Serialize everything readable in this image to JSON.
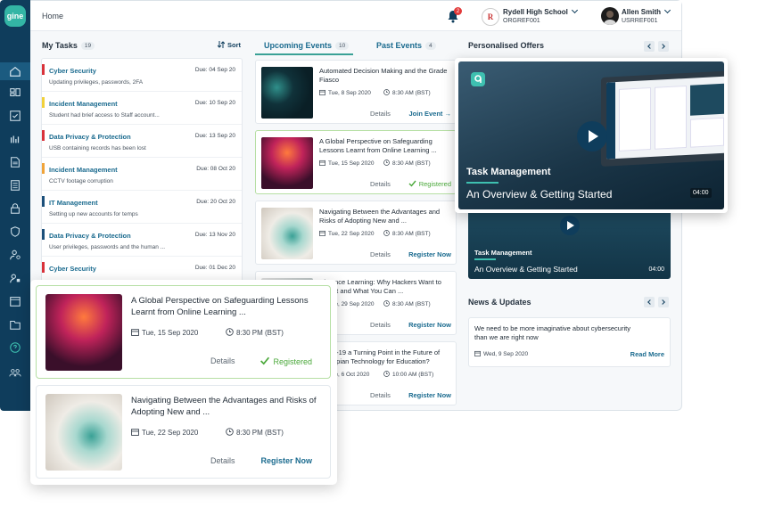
{
  "app": {
    "logo_text": "gine"
  },
  "topbar": {
    "breadcrumb": "Home",
    "notification_count": "2",
    "school_name": "Rydell High School",
    "school_code": "ORGREF001",
    "school_logo_letter": "R",
    "user_name": "Allen Smith",
    "user_code": "USRREF001"
  },
  "tasks": {
    "title": "My Tasks",
    "count": "19",
    "sort_label": "Sort",
    "items": [
      {
        "title": "Cyber Security",
        "due": "Due: 04 Sep 20",
        "desc": "Updating privileges, passwords, 2FA",
        "color": "#d9323a"
      },
      {
        "title": "Incident Management",
        "due": "Due: 10 Sep 20",
        "desc": "Student had brief access to Staff account...",
        "color": "#f1d13a"
      },
      {
        "title": "Data Privacy & Protection",
        "due": "Due: 13 Sep 20",
        "desc": "USB containing records has been lost",
        "color": "#d9323a"
      },
      {
        "title": "Incident Management",
        "due": "Due: 08 Oct 20",
        "desc": "CCTV footage corruption",
        "color": "#f0a43a"
      },
      {
        "title": "IT Management",
        "due": "Due: 20 Oct 20",
        "desc": "Setting up new accounts for temps",
        "color": "#1b4f7a"
      },
      {
        "title": "Data Privacy & Protection",
        "due": "Due: 13 Nov 20",
        "desc": "User privileges, passwords and the human ...",
        "color": "#1b4f7a"
      },
      {
        "title": "Cyber Security",
        "due": "Due: 01 Dec 20",
        "desc": "",
        "color": "#d9323a"
      }
    ]
  },
  "events": {
    "tab_upcoming": "Upcoming Events",
    "tab_upcoming_count": "10",
    "tab_past": "Past Events",
    "tab_past_count": "4",
    "items": [
      {
        "title": "Automated Decision Making and the Grade Fiasco",
        "date": "Tue, 8 Sep 2020",
        "time": "8:30 AM (BST)",
        "details": "Details",
        "action": "Join Event →",
        "status": "join"
      },
      {
        "title": "A Global Perspective on Safeguarding Lessons Learnt from Online Learning ...",
        "date": "Tue, 15 Sep 2020",
        "time": "8:30 AM (BST)",
        "details": "Details",
        "action": "Registered",
        "status": "registered"
      },
      {
        "title": "Navigating Between the Advantages and Risks of Adopting New and ...",
        "date": "Tue, 22 Sep 2020",
        "time": "8:30 AM (BST)",
        "details": "Details",
        "action": "Register Now",
        "status": "register"
      },
      {
        "title": "Distance Learning: Why Hackers Want to Stop it and What You Can ...",
        "date": "Tue, 29 Sep 2020",
        "time": "8:30 AM (BST)",
        "details": "Details",
        "action": "Register Now",
        "status": "register"
      },
      {
        "title": "Covid-19 a Turning Point in the Future of Dystopian Technology for Education?",
        "date": "Tue, 6 Oct 2020",
        "time": "10:00 AM (BST)",
        "details": "Details",
        "action": "Register Now",
        "status": "register"
      }
    ]
  },
  "offers": {
    "title": "Personalised Offers",
    "featured": {
      "title": "Task Management",
      "subtitle": "An Overview & Getting Started",
      "duration": "04:00"
    },
    "second": {
      "title": "Task Management",
      "subtitle": "An Overview & Getting Started",
      "duration": "04:00"
    }
  },
  "news": {
    "title": "News & Updates",
    "item": {
      "text": "We need to be more imaginative about cybersecurity than we are right now",
      "date": "Wed, 9 Sep 2020",
      "link": "Read More"
    }
  },
  "popup_events": [
    {
      "title": "A Global Perspective on Safeguarding Lessons Learnt from Online Learning ...",
      "date": "Tue, 15 Sep 2020",
      "time": "8:30 PM (BST)",
      "details": "Details",
      "action": "Registered",
      "status": "registered"
    },
    {
      "title": "Navigating Between the Advantages and Risks of Adopting New and ...",
      "date": "Tue, 22 Sep 2020",
      "time": "8:30 PM (BST)",
      "details": "Details",
      "action": "Register Now",
      "status": "register"
    }
  ],
  "sidebar": {
    "icons": [
      "home-icon",
      "dashboard-icon",
      "checklist-icon",
      "reports-icon",
      "documents-icon",
      "tasks-list-icon",
      "lock-icon",
      "shield-icon",
      "user-settings-icon",
      "admin-icon",
      "calendar-icon",
      "folder-icon",
      "help-icon",
      "team-icon"
    ]
  },
  "colors": {
    "brand": "#0f3d5c",
    "accent": "#3aa196",
    "registered": "#4aa83a",
    "link": "#1b6b8f"
  }
}
